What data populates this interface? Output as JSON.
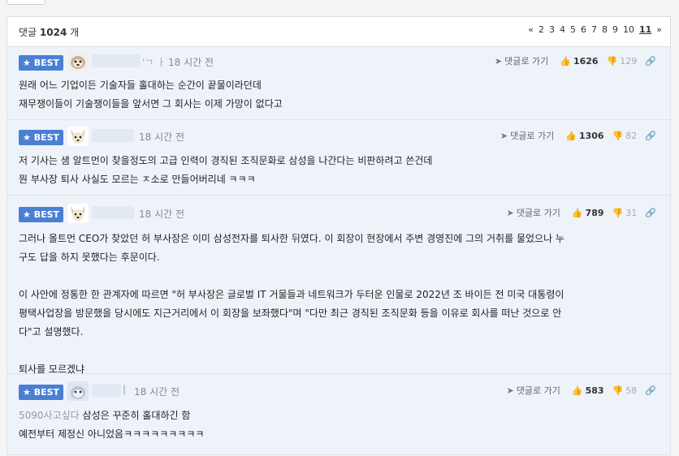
{
  "header": {
    "count_prefix": "댓글",
    "count_value": "1024",
    "count_suffix": "개",
    "pagination": [
      "«",
      "2",
      "3",
      "4",
      "5",
      "6",
      "7",
      "8",
      "9",
      "10",
      "11",
      "»"
    ],
    "current_page": "11"
  },
  "comments": [
    {
      "badge": "★ BEST",
      "nick_tail": "'ㄱ ㅏ",
      "time": "18 시간 전",
      "reply_label": "댓글로 가기",
      "up": "1626",
      "down": "129",
      "lines": [
        "원래 어느 기업이든 기술자들 홀대하는 순간이 끝물이라던데",
        "재무쟁이들이 기술쟁이들을 앞서면 그 회사는 이제 가망이 없다고"
      ]
    },
    {
      "badge": "★ BEST",
      "time": "18 시간 전",
      "reply_label": "댓글로 가기",
      "up": "1306",
      "down": "82",
      "lines": [
        "저 기사는 샘 알트먼이 찾을정도의 고급 인력이 경직된 조직문화로 삼성을 나간다는 비판하려고 쓴건데",
        "뭔 부사장 퇴사 사실도 모르는 ㅈ소로 만들어버리네 ㅋㅋㅋ"
      ]
    },
    {
      "badge": "★ BEST",
      "time": "18 시간 전",
      "reply_label": "댓글로 가기",
      "up": "789",
      "down": "31",
      "lines": [
        "그러나 올트먼 CEO가 찾았던 허 부사장은 이미 삼성전자를 퇴사한 뒤였다. 이 회장이 현장에서 주변 경영진에 그의 거취를 물었으나 누",
        "구도 답을 하지 못했다는 후문이다.",
        "",
        "이 사안에 정통한 한 관계자에 따르면 \"허 부사장은 글로벌 IT 거물들과 네트워크가 두터운 인물로 2022년 조 바이든 전 미국 대통령이",
        "평택사업장을 방문했을 당시에도 지근거리에서 이 회장을 보좌했다\"며 \"다만 최근 경직된 조직문화 등을 이유로 회사를 떠난 것으로 안",
        "다\"고 설명했다.",
        "",
        "퇴사를 모르겠냐"
      ]
    },
    {
      "badge": "★ BEST",
      "nick_tail": "|",
      "time": "18 시간 전",
      "reply_label": "댓글로 가기",
      "up": "583",
      "down": "58",
      "quote": "5090사고싶다",
      "lines": [
        "삼성은 꾸준히 홀대하긴 함",
        "예전부터 제정신 아니었음ㅋㅋㅋㅋㅋㅋㅋㅋㅋ"
      ]
    }
  ]
}
